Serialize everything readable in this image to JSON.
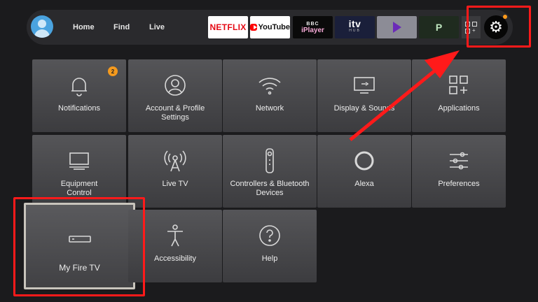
{
  "nav": {
    "items": [
      {
        "label": "Home"
      },
      {
        "label": "Find"
      },
      {
        "label": "Live"
      }
    ]
  },
  "apps": {
    "netflix": "NETFLIX",
    "youtube": "YouTube",
    "bbc_top": "BBC",
    "bbc_bottom": "iPlayer",
    "itv_top": "itv",
    "itv_bottom": "HUB",
    "plex": "P"
  },
  "settings_icon": "⚙",
  "tiles": [
    {
      "label": "Notifications",
      "icon": "bell-icon",
      "badge": "2"
    },
    {
      "label": "Account & Profile\nSettings",
      "icon": "profile-icon"
    },
    {
      "label": "Network",
      "icon": "wifi-icon"
    },
    {
      "label": "Display & Sounds",
      "icon": "display-icon"
    },
    {
      "label": "Applications",
      "icon": "apps-icon"
    },
    {
      "label": "Equipment\nControl",
      "icon": "monitor-icon"
    },
    {
      "label": "Live TV",
      "icon": "antenna-icon"
    },
    {
      "label": "Controllers & Bluetooth\nDevices",
      "icon": "remote-icon"
    },
    {
      "label": "Alexa",
      "icon": "alexa-icon"
    },
    {
      "label": "Preferences",
      "icon": "sliders-icon"
    },
    {
      "label": "My Fire TV",
      "icon": "firetv-icon"
    },
    {
      "label": "Accessibility",
      "icon": "accessibility-icon"
    },
    {
      "label": "Help",
      "icon": "help-icon"
    }
  ],
  "colors": {
    "annotation": "#ff1a1a",
    "badge": "#f59a1e",
    "accent_avatar": "#4aa3df"
  }
}
